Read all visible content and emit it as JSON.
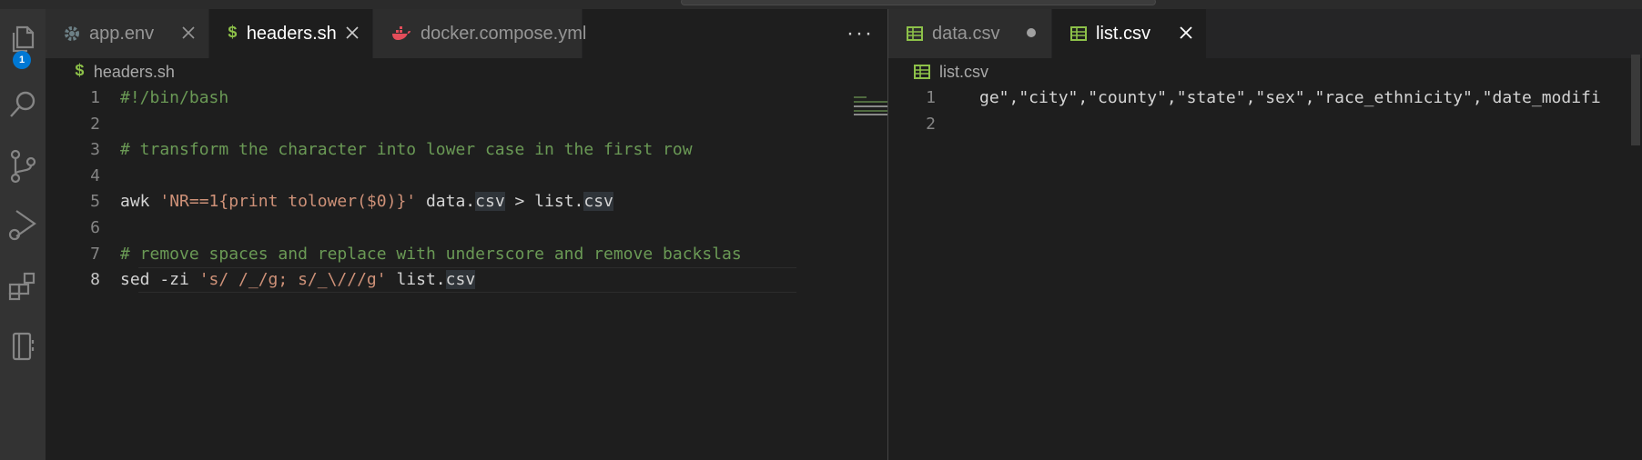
{
  "activity_bar": {
    "badge_count": "1",
    "icons": [
      "explorer-icon",
      "search-icon",
      "source-control-icon",
      "run-debug-icon",
      "extensions-icon",
      "notebook-icon"
    ]
  },
  "group1": {
    "tabs": [
      {
        "label": "app.env",
        "icon": "gear-icon",
        "active": false,
        "closable": true
      },
      {
        "label": "headers.sh",
        "icon": "dollar-icon",
        "active": true,
        "closable": true
      },
      {
        "label": "docker.compose.yml",
        "icon": "docker-icon",
        "active": false,
        "closable": false
      }
    ],
    "more_actions": "···",
    "breadcrumb": {
      "icon_text": "$",
      "file": "headers.sh"
    },
    "lines": [
      {
        "number": "1",
        "segments": [
          {
            "t": "#!/bin/bash",
            "c": "comment"
          }
        ]
      },
      {
        "number": "2",
        "segments": []
      },
      {
        "number": "3",
        "segments": [
          {
            "t": "# transform the character into lower case in the first row",
            "c": "comment"
          }
        ]
      },
      {
        "number": "4",
        "segments": []
      },
      {
        "number": "5",
        "segments": [
          {
            "t": "awk ",
            "c": ""
          },
          {
            "t": "'NR==1{print tolower($0)}'",
            "c": "str"
          },
          {
            "t": " data.",
            "c": ""
          },
          {
            "t": "csv",
            "c": "hl"
          },
          {
            "t": " > list.",
            "c": ""
          },
          {
            "t": "csv",
            "c": "hl"
          }
        ]
      },
      {
        "number": "6",
        "segments": []
      },
      {
        "number": "7",
        "segments": [
          {
            "t": "# remove spaces and replace with underscore and remove backslas",
            "c": "comment"
          }
        ]
      },
      {
        "number": "8",
        "segments": [
          {
            "t": "sed -zi ",
            "c": ""
          },
          {
            "t": "'s/ /_/g; s/_\\///g'",
            "c": "str"
          },
          {
            "t": " list.",
            "c": ""
          },
          {
            "t": "csv",
            "c": "hl"
          }
        ]
      }
    ],
    "current_line": "8"
  },
  "group2": {
    "tabs": [
      {
        "label": "data.csv",
        "icon": "table-icon",
        "active": false,
        "dirty": true
      },
      {
        "label": "list.csv",
        "icon": "table-icon",
        "active": true,
        "dirty": false
      }
    ],
    "breadcrumb": {
      "file": "list.csv"
    },
    "lines": [
      {
        "number": "1",
        "text": "ge\",\"city\",\"county\",\"state\",\"sex\",\"race_ethnicity\",\"date_modifi"
      },
      {
        "number": "2",
        "text": ""
      }
    ]
  },
  "colors": {
    "comment": "#6a9955",
    "string": "#ce9178",
    "accent": "#0078d4",
    "csv_icon": "#8dc149"
  }
}
